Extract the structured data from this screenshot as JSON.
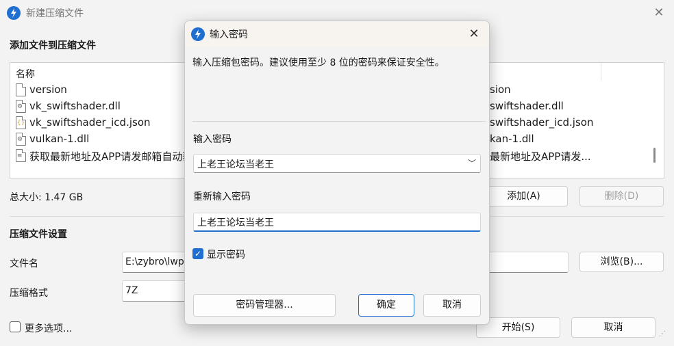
{
  "main": {
    "title": "新建压缩文件",
    "add_section_label": "添加文件到压缩文件",
    "list_column_name": "名称",
    "files": [
      {
        "name": "version",
        "kind": "file"
      },
      {
        "name": "vk_swiftshader.dll",
        "kind": "dll"
      },
      {
        "name": "vk_swiftshader_icd.json",
        "kind": "json"
      },
      {
        "name": "vulkan-1.dll",
        "kind": "dll"
      },
      {
        "name": "获取最新地址及APP请发邮箱自动获",
        "kind": "text"
      }
    ],
    "files_right_visible": [
      "sion",
      "swiftshader.dll",
      "swiftshader_icd.json",
      "kan-1.dll",
      "最新地址及APP请发..."
    ],
    "total_size": "总大小: 1.47 GB",
    "add_button": "添加(A)",
    "delete_button": "删除(D)",
    "settings_section_label": "压缩文件设置",
    "filename_label": "文件名",
    "filename_value": "E:\\zybro\\lwp",
    "browse_button": "浏览(B)...",
    "format_label": "压缩格式",
    "format_value": "7Z",
    "more_options_label": "更多选项...",
    "start_button": "开始(S)",
    "cancel_button": "取消"
  },
  "dialog": {
    "title": "输入密码",
    "hint": "输入压缩包密码。建议使用至少 8 位的密码来保证安全性。",
    "password_label": "输入密码",
    "password_value": "上老王论坛当老王",
    "reenter_label": "重新输入密码",
    "reenter_value": "上老王论坛当老王",
    "show_password_label": "显示密码",
    "show_password_checked": true,
    "password_manager_button": "密码管理器...",
    "ok_button": "确定",
    "cancel_button": "取消"
  },
  "colors": {
    "accent": "#1f6fd1",
    "window_bg": "#f3f3f3",
    "dialog_title_bg": "#f7f3ef"
  }
}
